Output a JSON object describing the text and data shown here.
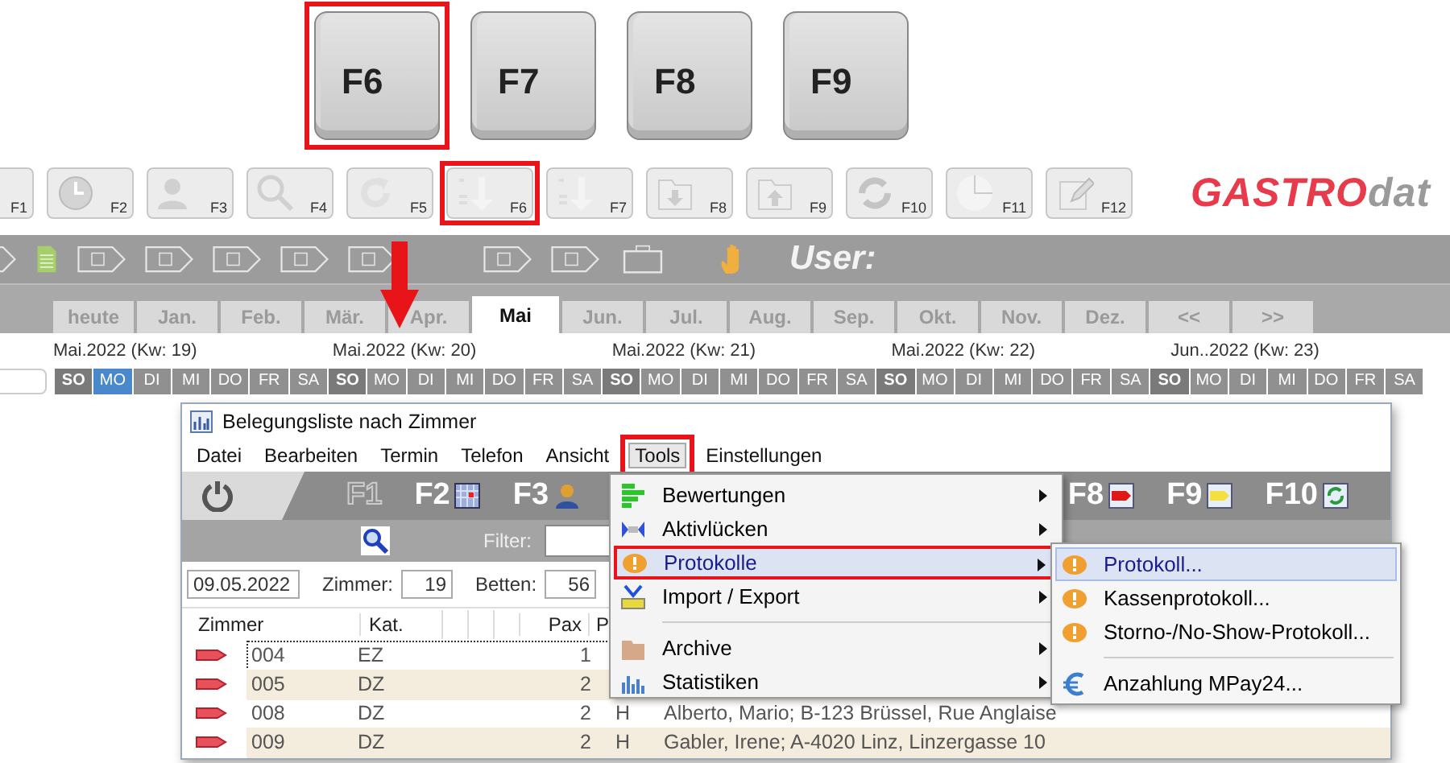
{
  "function_keys": [
    {
      "label": "F6",
      "highlighted": true
    },
    {
      "label": "F7",
      "highlighted": false
    },
    {
      "label": "F8",
      "highlighted": false
    },
    {
      "label": "F9",
      "highlighted": false
    }
  ],
  "toolbar": {
    "buttons": [
      {
        "key": "F1",
        "kind": "blank",
        "highlighted": false
      },
      {
        "key": "F2",
        "kind": "clock",
        "highlighted": false
      },
      {
        "key": "F3",
        "kind": "person",
        "highlighted": false
      },
      {
        "key": "F4",
        "kind": "search",
        "highlighted": false
      },
      {
        "key": "F5",
        "kind": "refresh",
        "highlighted": false
      },
      {
        "key": "F6",
        "kind": "sort-number",
        "highlighted": true
      },
      {
        "key": "F7",
        "kind": "sort-alpha",
        "highlighted": false
      },
      {
        "key": "F8",
        "kind": "folder-down",
        "highlighted": false
      },
      {
        "key": "F9",
        "kind": "folder-up",
        "highlighted": false
      },
      {
        "key": "F10",
        "kind": "sync",
        "highlighted": false
      },
      {
        "key": "F11",
        "kind": "pie",
        "highlighted": false
      },
      {
        "key": "F12",
        "kind": "pencil",
        "highlighted": false
      }
    ]
  },
  "logo": {
    "part_1": "GASTRO",
    "part_2": "dat"
  },
  "user_label": "User:",
  "month_tabs": [
    {
      "label": "heute",
      "selected": false
    },
    {
      "label": "Jan.",
      "selected": false
    },
    {
      "label": "Feb.",
      "selected": false
    },
    {
      "label": "Mär.",
      "selected": false
    },
    {
      "label": "Apr.",
      "selected": false
    },
    {
      "label": "Mai",
      "selected": true
    },
    {
      "label": "Jun.",
      "selected": false
    },
    {
      "label": "Jul.",
      "selected": false
    },
    {
      "label": "Aug.",
      "selected": false
    },
    {
      "label": "Sep.",
      "selected": false
    },
    {
      "label": "Okt.",
      "selected": false
    },
    {
      "label": "Nov.",
      "selected": false
    },
    {
      "label": "Dez.",
      "selected": false
    },
    {
      "label": "<<",
      "selected": false
    },
    {
      "label": ">>",
      "selected": false
    }
  ],
  "weeks": [
    "Mai.2022 (Kw: 19)",
    "Mai.2022 (Kw: 20)",
    "Mai.2022 (Kw: 21)",
    "Mai.2022 (Kw: 22)",
    "Jun..2022 (Kw: 23)"
  ],
  "days": [
    {
      "label": "SO",
      "kind": "sunday",
      "selected": false
    },
    {
      "label": "MO",
      "kind": "weekday",
      "selected": true
    },
    {
      "label": "DI",
      "kind": "weekday",
      "selected": false
    },
    {
      "label": "MI",
      "kind": "weekday",
      "selected": false
    },
    {
      "label": "DO",
      "kind": "weekday",
      "selected": false
    },
    {
      "label": "FR",
      "kind": "weekday",
      "selected": false
    },
    {
      "label": "SA",
      "kind": "weekday",
      "selected": false
    },
    {
      "label": "SO",
      "kind": "sunday",
      "selected": false
    },
    {
      "label": "MO",
      "kind": "weekday",
      "selected": false
    },
    {
      "label": "DI",
      "kind": "weekday",
      "selected": false
    },
    {
      "label": "MI",
      "kind": "weekday",
      "selected": false
    },
    {
      "label": "DO",
      "kind": "weekday",
      "selected": false
    },
    {
      "label": "FR",
      "kind": "weekday",
      "selected": false
    },
    {
      "label": "SA",
      "kind": "weekday",
      "selected": false
    },
    {
      "label": "SO",
      "kind": "sunday",
      "selected": false
    },
    {
      "label": "MO",
      "kind": "weekday",
      "selected": false
    },
    {
      "label": "DI",
      "kind": "weekday",
      "selected": false
    },
    {
      "label": "MI",
      "kind": "weekday",
      "selected": false
    },
    {
      "label": "DO",
      "kind": "weekday",
      "selected": false
    },
    {
      "label": "FR",
      "kind": "weekday",
      "selected": false
    },
    {
      "label": "SA",
      "kind": "weekday",
      "selected": false
    },
    {
      "label": "SO",
      "kind": "sunday",
      "selected": false
    },
    {
      "label": "MO",
      "kind": "weekday",
      "selected": false
    },
    {
      "label": "DI",
      "kind": "weekday",
      "selected": false
    },
    {
      "label": "MI",
      "kind": "weekday",
      "selected": false
    },
    {
      "label": "DO",
      "kind": "weekday",
      "selected": false
    },
    {
      "label": "FR",
      "kind": "weekday",
      "selected": false
    },
    {
      "label": "SA",
      "kind": "weekday",
      "selected": false
    },
    {
      "label": "SO",
      "kind": "sunday",
      "selected": false
    },
    {
      "label": "MO",
      "kind": "weekday",
      "selected": false
    },
    {
      "label": "DI",
      "kind": "weekday",
      "selected": false
    },
    {
      "label": "MI",
      "kind": "weekday",
      "selected": false
    },
    {
      "label": "DO",
      "kind": "weekday",
      "selected": false
    },
    {
      "label": "FR",
      "kind": "weekday",
      "selected": false
    },
    {
      "label": "SA",
      "kind": "weekday",
      "selected": false
    }
  ],
  "window": {
    "title": "Belegungsliste nach Zimmer",
    "menu": [
      {
        "label": "Datei",
        "selected": false
      },
      {
        "label": "Bearbeiten",
        "selected": false
      },
      {
        "label": "Termin",
        "selected": false
      },
      {
        "label": "Telefon",
        "selected": false
      },
      {
        "label": "Ansicht",
        "selected": false
      },
      {
        "label": "Tools",
        "selected": true
      },
      {
        "label": "Einstellungen",
        "selected": false
      }
    ],
    "toolbar_keys": [
      {
        "label": "F1",
        "disabled": true,
        "kind": "none"
      },
      {
        "label": "F2",
        "disabled": false,
        "kind": "calendar"
      },
      {
        "label": "F3",
        "disabled": false,
        "kind": "person"
      },
      {
        "label": "F8",
        "disabled": false,
        "kind": "red-tag"
      },
      {
        "label": "F9",
        "disabled": false,
        "kind": "yellow-tag"
      },
      {
        "label": "F10",
        "disabled": false,
        "kind": "refresh"
      }
    ],
    "filter_label": "Filter:",
    "date": "09.05.2022",
    "rooms_label": "Zimmer:",
    "rooms": "19",
    "beds_label": "Betten:",
    "beds": "56",
    "table": {
      "columns": [
        "Zimmer",
        "Kat.",
        "Pax",
        "P"
      ],
      "rows": [
        {
          "room": "004",
          "category": "EZ",
          "pax": "1",
          "focused": true
        },
        {
          "room": "005",
          "category": "DZ",
          "pax": "2",
          "focused": false
        },
        {
          "room": "008",
          "category": "DZ",
          "pax": "2",
          "column_5": "H",
          "guest": "Alberto, Mario;  B-123 Brüssel, Rue Anglaise",
          "focused": false
        },
        {
          "room": "009",
          "category": "DZ",
          "pax": "2",
          "column_5": "H",
          "guest": "Gabler, Irene;  A-4020 Linz, Linzergasse 10",
          "focused": false
        }
      ]
    }
  },
  "tools_menu": [
    {
      "kind": "item",
      "label": "Bewertungen",
      "selected": false,
      "submenu": true,
      "highlighted": false
    },
    {
      "kind": "item",
      "label": "Aktivlücken",
      "selected": false,
      "submenu": true,
      "highlighted": false
    },
    {
      "kind": "item",
      "label": "Protokolle",
      "selected": true,
      "submenu": true,
      "highlighted": true
    },
    {
      "kind": "item",
      "label": "Import / Export",
      "selected": false,
      "submenu": true,
      "highlighted": false
    },
    {
      "kind": "separator"
    },
    {
      "kind": "item",
      "label": "Archive",
      "selected": false,
      "submenu": true,
      "highlighted": false
    },
    {
      "kind": "item",
      "label": "Statistiken",
      "selected": false,
      "submenu": true,
      "highlighted": false
    }
  ],
  "submenu": [
    {
      "kind": "item",
      "label": "Protokoll...",
      "selected": true
    },
    {
      "kind": "item",
      "label": "Kassenprotokoll...",
      "selected": false
    },
    {
      "kind": "item",
      "label": "Storno-/No-Show-Protokoll...",
      "selected": false
    },
    {
      "kind": "separator"
    },
    {
      "kind": "item",
      "label": "Anzahlung MPay24...",
      "selected": false
    }
  ]
}
